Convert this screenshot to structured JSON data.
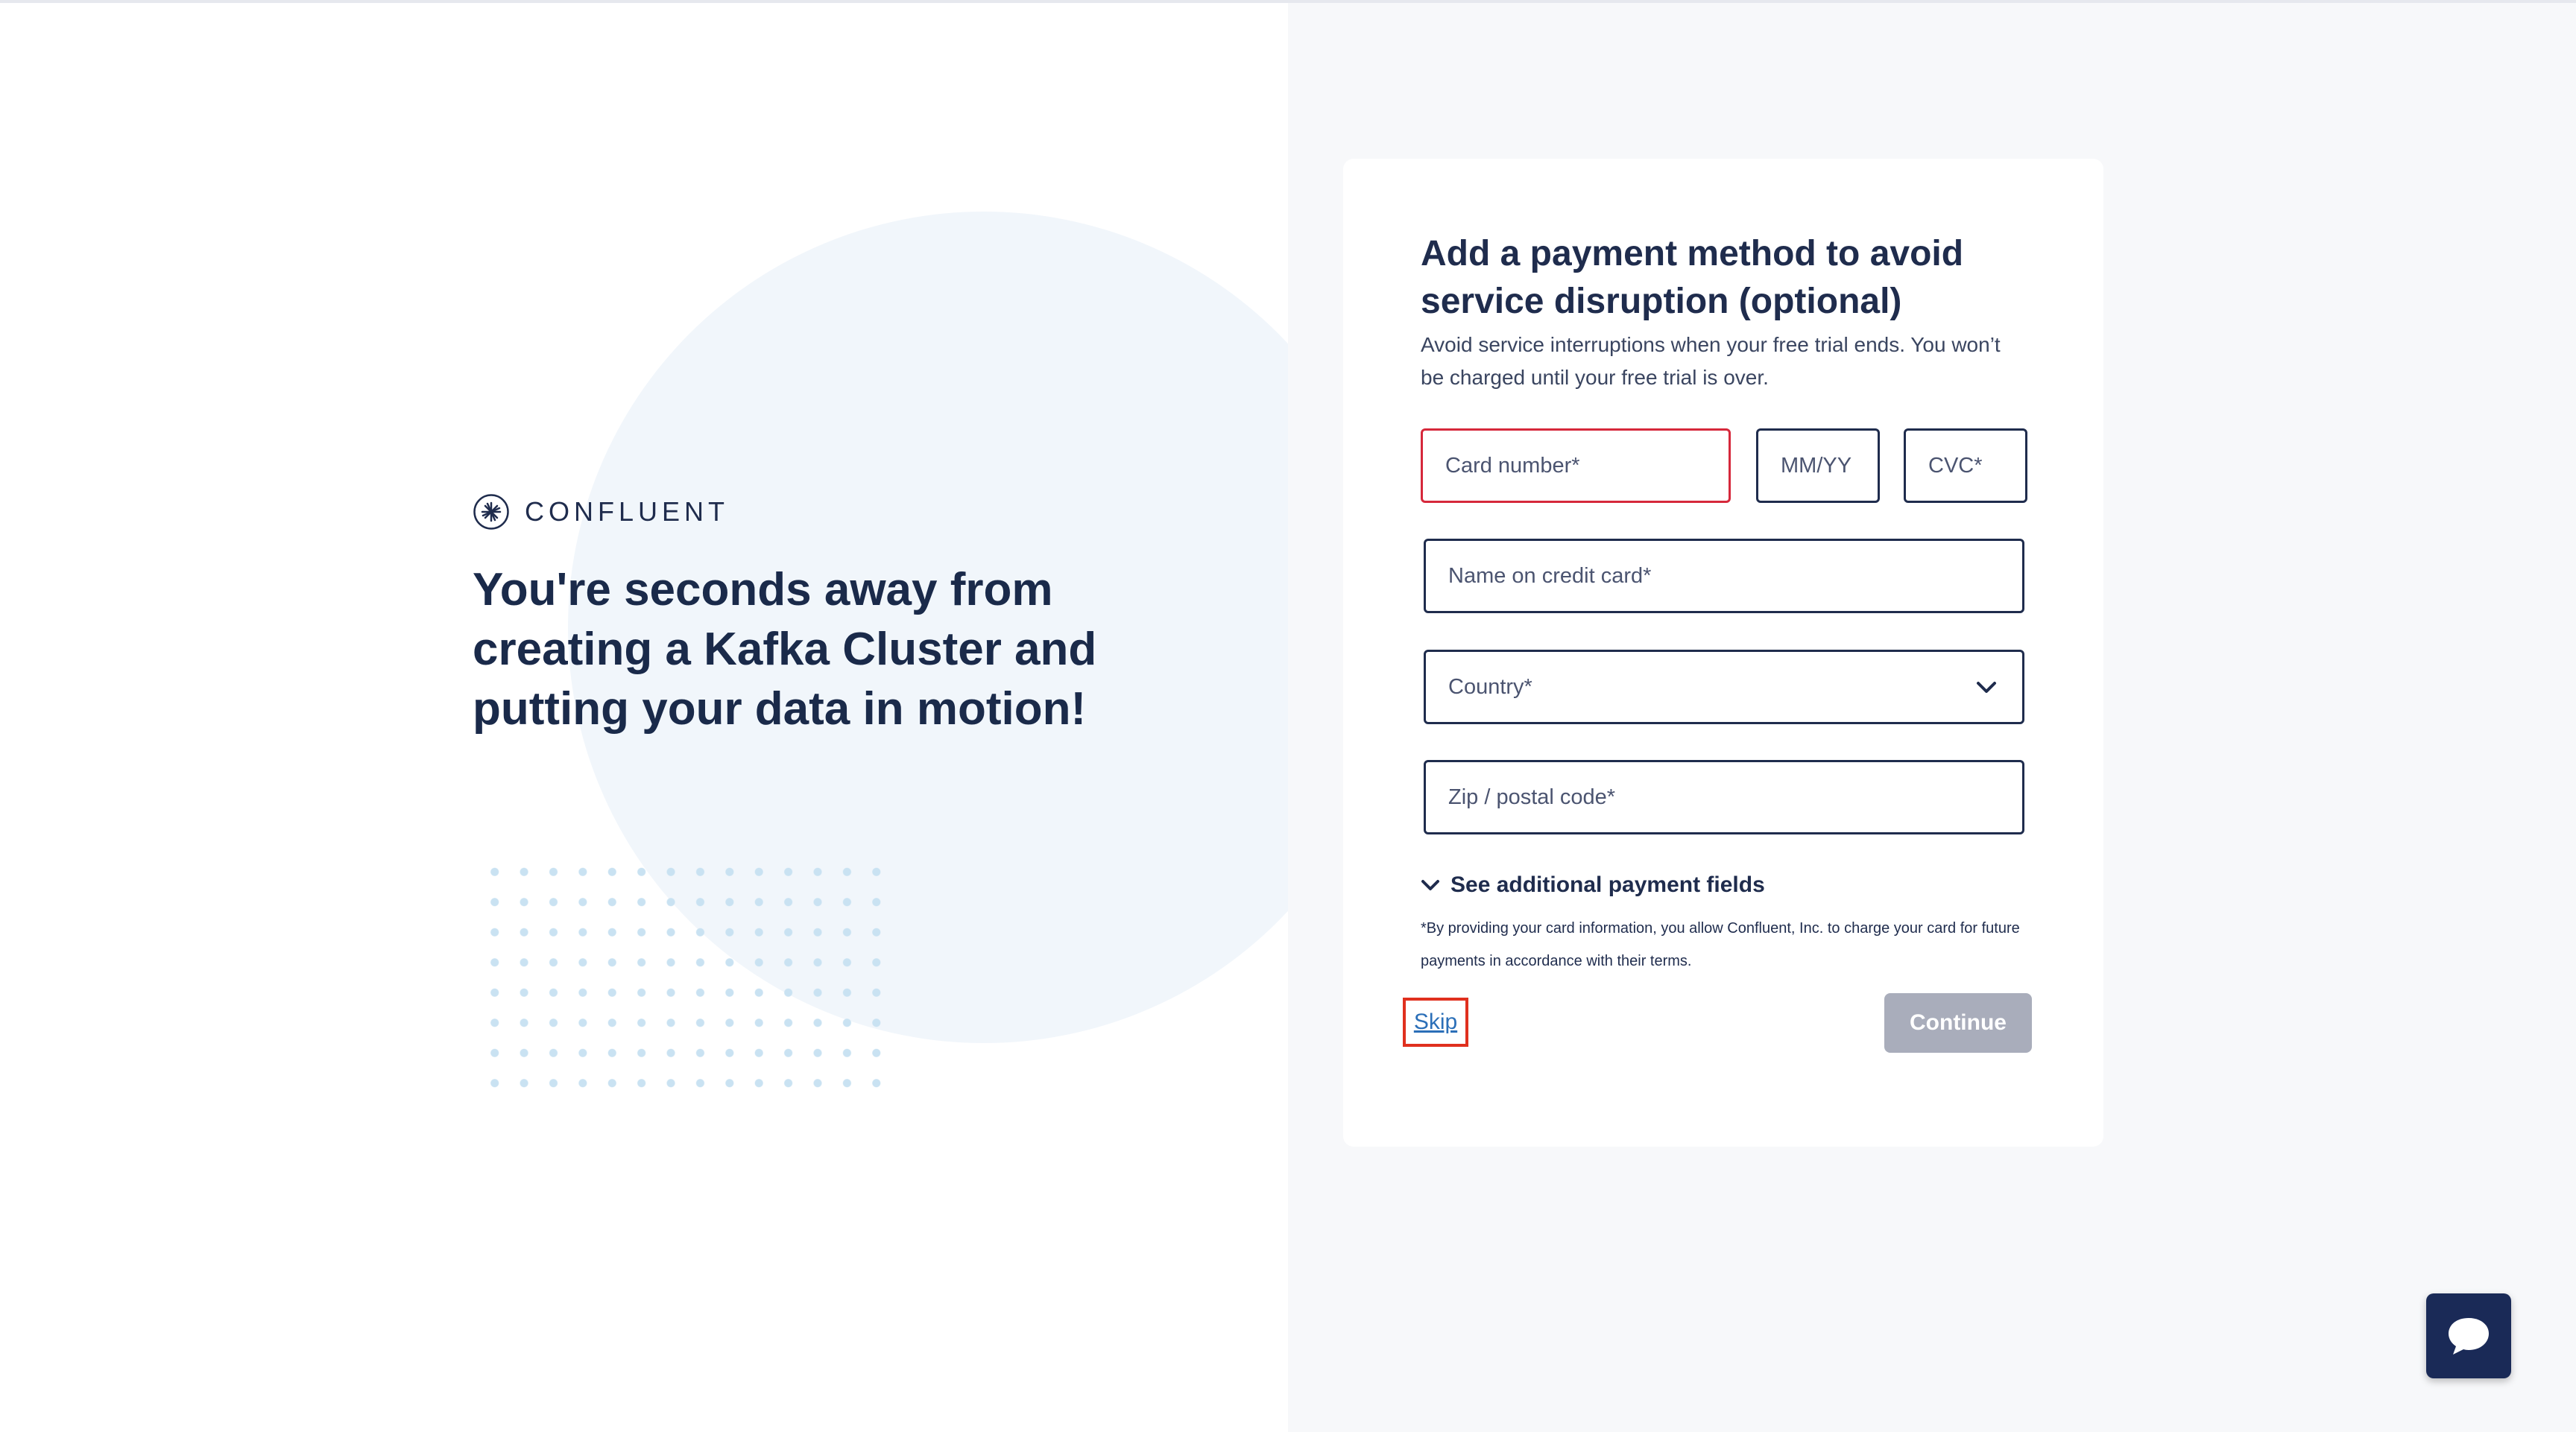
{
  "brand": {
    "name": "CONFLUENT",
    "icon": "confluent-logo-icon"
  },
  "hero": {
    "headline": "You're seconds away from creating a Kafka Cluster and putting your data in motion!"
  },
  "form": {
    "title": "Add a payment method to avoid service disruption (optional)",
    "subtitle": "Avoid service interruptions when your free trial ends. You won’t be charged until your free trial is over.",
    "card_number_placeholder": "Card number*",
    "expiry_placeholder": "MM/YY",
    "cvc_placeholder": "CVC*",
    "name_placeholder": "Name on credit card*",
    "country_placeholder": "Country*",
    "zip_placeholder": "Zip / postal code*",
    "additional_fields_label": "See additional payment fields",
    "legal_text": "*By providing your card information, you allow Confluent, Inc. to charge your card for future payments in accordance with their terms.",
    "skip_label": "Skip",
    "continue_label": "Continue"
  },
  "colors": {
    "navy": "#1f2c4d",
    "error_border": "#d6283b",
    "disabled_button": "#a9adbb",
    "link": "#2b6fb8",
    "highlight": "#e0301e",
    "chat_button": "#1a2a57"
  },
  "chat": {
    "icon": "chat-bubble-icon"
  }
}
